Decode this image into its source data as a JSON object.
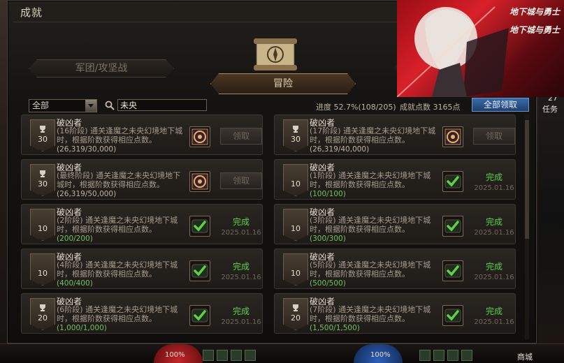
{
  "window": {
    "title": "成就"
  },
  "tabs": {
    "guild": "军团/攻坚战",
    "adventure": "冒险"
  },
  "filter": {
    "selected": "全部"
  },
  "search": {
    "value": "未央"
  },
  "summary": {
    "progress": "进度 52.7%(108/205)",
    "points": "成就点数 3165点",
    "claim_all": "全部领取"
  },
  "achievements": [
    {
      "points": "30",
      "trophy": true,
      "title": "破凶者",
      "desc": "(16阶段) 通关逢魔之未央幻境地下城时，根据阶数获得相应点数。",
      "progress": "(26,319/30,000)",
      "status": "pending",
      "action": "领取",
      "date": ""
    },
    {
      "points": "30",
      "trophy": true,
      "title": "破凶者",
      "desc": "(17阶段) 通关逢魔之未央幻境地下城时，根据阶数获得相应点数。",
      "progress": "(26,319/40,000)",
      "status": "pending",
      "action": "领取",
      "date": ""
    },
    {
      "points": "30",
      "trophy": true,
      "title": "破凶者",
      "desc": "(最终阶段) 通关逢魔之未央幻境地下城时，根据阶数获得相应点数。",
      "progress": "(26,319/50,000)",
      "status": "pending",
      "action": "领取",
      "date": ""
    },
    {
      "points": "10",
      "trophy": false,
      "title": "破凶者",
      "desc": "(1阶段) 通关逢魔之未央幻境地下城时，根据阶数获得相应点数。",
      "progress": "(100/100)",
      "status": "done",
      "action": "完成",
      "date": "2025.01.16"
    },
    {
      "points": "10",
      "trophy": false,
      "title": "破凶者",
      "desc": "(2阶段) 通关逢魔之未央幻境地下城时，根据阶数获得相应点数。",
      "progress": "(200/200)",
      "status": "done",
      "action": "完成",
      "date": "2025.01.16"
    },
    {
      "points": "10",
      "trophy": false,
      "title": "破凶者",
      "desc": "(3阶段) 通关逢魔之未央幻境地下城时，根据阶数获得相应点数。",
      "progress": "(300/300)",
      "status": "done",
      "action": "完成",
      "date": "2025.01.16"
    },
    {
      "points": "10",
      "trophy": false,
      "title": "破凶者",
      "desc": "(4阶段) 通关逢魔之未央幻境地下城时，根据阶数获得相应点数。",
      "progress": "(400/400)",
      "status": "done",
      "action": "完成",
      "date": "2025.01.16"
    },
    {
      "points": "10",
      "trophy": false,
      "title": "破凶者",
      "desc": "(5阶段) 通关逢魔之未央幻境地下城时，根据阶数获得相应点数。",
      "progress": "(500/500)",
      "status": "done",
      "action": "完成",
      "date": "2025.01.16"
    },
    {
      "points": "20",
      "trophy": true,
      "title": "破凶者",
      "desc": "(6阶段) 通关逢魔之未央幻境地下城时，根据阶数获得相应点数。",
      "progress": "(1,000/1,000)",
      "status": "done",
      "action": "完成",
      "date": "2025.01.16"
    },
    {
      "points": "20",
      "trophy": true,
      "title": "破凶者",
      "desc": "(7阶段) 通关逢魔之未央幻境地下城时，根据阶数获得相应点数。",
      "progress": "(1,500/1,500)",
      "status": "done",
      "action": "完成",
      "date": "2025.01.16"
    }
  ],
  "banner": {
    "logo_top": "地下城与勇士",
    "logo_bottom": "地下城与勇士"
  },
  "right_strip": {
    "text1": "27",
    "text2": "任务"
  },
  "taskbar": {
    "hp": "100%",
    "mp": "100%",
    "shop": "商城"
  },
  "icons": {
    "search": "search-icon",
    "trophy": "trophy-icon",
    "reward": "reward-emblem-icon",
    "done": "checkmark-icon",
    "dropdown": "chevron-down-icon"
  },
  "colors": {
    "done_green": "#5fcf4a",
    "accent_blue": "#3c6aa6"
  }
}
